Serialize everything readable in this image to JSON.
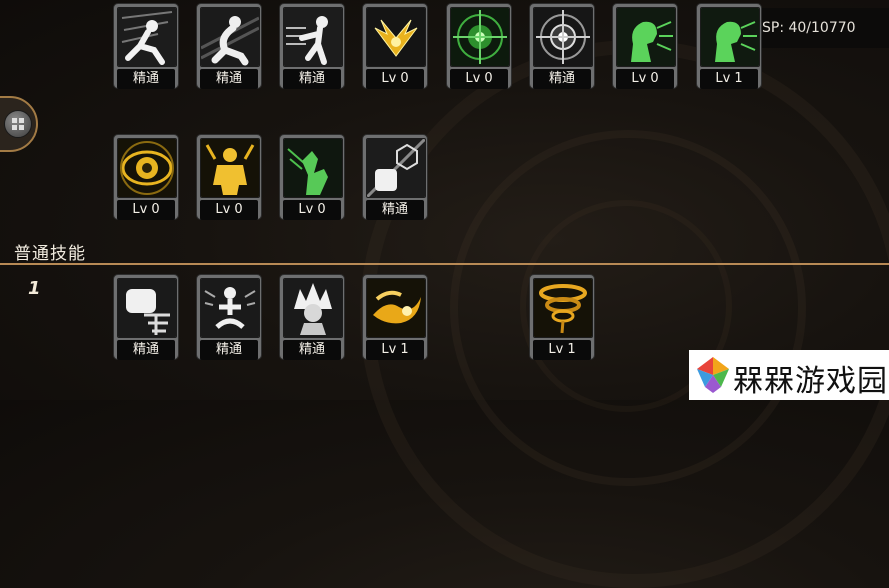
{
  "sp": {
    "label": "SP: 40/10770"
  },
  "section": {
    "title": "普通技能",
    "level": "1"
  },
  "upper_row1": [
    {
      "icon": "dash-kick-icon",
      "label": "精通"
    },
    {
      "icon": "crouch-grapple-icon",
      "label": "精通"
    },
    {
      "icon": "palm-strike-icon",
      "label": "精通"
    },
    {
      "icon": "golden-wings-icon",
      "label": "Lv 0"
    },
    {
      "icon": "green-target-icon",
      "label": "Lv 0"
    },
    {
      "icon": "white-target-icon",
      "label": "精通"
    },
    {
      "icon": "green-roar-icon",
      "label": "Lv 0"
    },
    {
      "icon": "green-roar-icon",
      "label": "Lv 1"
    }
  ],
  "upper_row2": [
    {
      "icon": "golden-eye-icon",
      "label": "Lv 0"
    },
    {
      "icon": "golden-fighter-icon",
      "label": "Lv 0"
    },
    {
      "icon": "green-hand-icon",
      "label": "Lv 0"
    },
    {
      "icon": "fist-emblem-icon",
      "label": "精通"
    }
  ],
  "basic_row": [
    {
      "icon": "burst-fist-icon",
      "label": "精通"
    },
    {
      "icon": "meditation-icon",
      "label": "精通"
    },
    {
      "icon": "spiky-hair-icon",
      "label": "精通"
    },
    {
      "icon": "golden-flame-icon",
      "label": "Lv 1"
    },
    {
      "icon": "golden-tornado-icon",
      "label": "Lv 1"
    }
  ],
  "watermark": {
    "text": "槑槑游戏园"
  }
}
